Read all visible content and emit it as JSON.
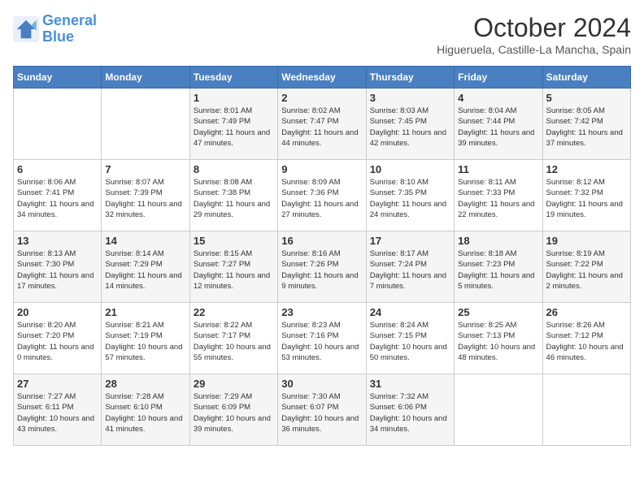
{
  "header": {
    "logo_line1": "General",
    "logo_line2": "Blue",
    "month": "October 2024",
    "location": "Higueruela, Castille-La Mancha, Spain"
  },
  "days_of_week": [
    "Sunday",
    "Monday",
    "Tuesday",
    "Wednesday",
    "Thursday",
    "Friday",
    "Saturday"
  ],
  "weeks": [
    [
      {
        "day": "",
        "sunrise": "",
        "sunset": "",
        "daylight": ""
      },
      {
        "day": "",
        "sunrise": "",
        "sunset": "",
        "daylight": ""
      },
      {
        "day": "1",
        "sunrise": "Sunrise: 8:01 AM",
        "sunset": "Sunset: 7:49 PM",
        "daylight": "Daylight: 11 hours and 47 minutes."
      },
      {
        "day": "2",
        "sunrise": "Sunrise: 8:02 AM",
        "sunset": "Sunset: 7:47 PM",
        "daylight": "Daylight: 11 hours and 44 minutes."
      },
      {
        "day": "3",
        "sunrise": "Sunrise: 8:03 AM",
        "sunset": "Sunset: 7:45 PM",
        "daylight": "Daylight: 11 hours and 42 minutes."
      },
      {
        "day": "4",
        "sunrise": "Sunrise: 8:04 AM",
        "sunset": "Sunset: 7:44 PM",
        "daylight": "Daylight: 11 hours and 39 minutes."
      },
      {
        "day": "5",
        "sunrise": "Sunrise: 8:05 AM",
        "sunset": "Sunset: 7:42 PM",
        "daylight": "Daylight: 11 hours and 37 minutes."
      }
    ],
    [
      {
        "day": "6",
        "sunrise": "Sunrise: 8:06 AM",
        "sunset": "Sunset: 7:41 PM",
        "daylight": "Daylight: 11 hours and 34 minutes."
      },
      {
        "day": "7",
        "sunrise": "Sunrise: 8:07 AM",
        "sunset": "Sunset: 7:39 PM",
        "daylight": "Daylight: 11 hours and 32 minutes."
      },
      {
        "day": "8",
        "sunrise": "Sunrise: 8:08 AM",
        "sunset": "Sunset: 7:38 PM",
        "daylight": "Daylight: 11 hours and 29 minutes."
      },
      {
        "day": "9",
        "sunrise": "Sunrise: 8:09 AM",
        "sunset": "Sunset: 7:36 PM",
        "daylight": "Daylight: 11 hours and 27 minutes."
      },
      {
        "day": "10",
        "sunrise": "Sunrise: 8:10 AM",
        "sunset": "Sunset: 7:35 PM",
        "daylight": "Daylight: 11 hours and 24 minutes."
      },
      {
        "day": "11",
        "sunrise": "Sunrise: 8:11 AM",
        "sunset": "Sunset: 7:33 PM",
        "daylight": "Daylight: 11 hours and 22 minutes."
      },
      {
        "day": "12",
        "sunrise": "Sunrise: 8:12 AM",
        "sunset": "Sunset: 7:32 PM",
        "daylight": "Daylight: 11 hours and 19 minutes."
      }
    ],
    [
      {
        "day": "13",
        "sunrise": "Sunrise: 8:13 AM",
        "sunset": "Sunset: 7:30 PM",
        "daylight": "Daylight: 11 hours and 17 minutes."
      },
      {
        "day": "14",
        "sunrise": "Sunrise: 8:14 AM",
        "sunset": "Sunset: 7:29 PM",
        "daylight": "Daylight: 11 hours and 14 minutes."
      },
      {
        "day": "15",
        "sunrise": "Sunrise: 8:15 AM",
        "sunset": "Sunset: 7:27 PM",
        "daylight": "Daylight: 11 hours and 12 minutes."
      },
      {
        "day": "16",
        "sunrise": "Sunrise: 8:16 AM",
        "sunset": "Sunset: 7:26 PM",
        "daylight": "Daylight: 11 hours and 9 minutes."
      },
      {
        "day": "17",
        "sunrise": "Sunrise: 8:17 AM",
        "sunset": "Sunset: 7:24 PM",
        "daylight": "Daylight: 11 hours and 7 minutes."
      },
      {
        "day": "18",
        "sunrise": "Sunrise: 8:18 AM",
        "sunset": "Sunset: 7:23 PM",
        "daylight": "Daylight: 11 hours and 5 minutes."
      },
      {
        "day": "19",
        "sunrise": "Sunrise: 8:19 AM",
        "sunset": "Sunset: 7:22 PM",
        "daylight": "Daylight: 11 hours and 2 minutes."
      }
    ],
    [
      {
        "day": "20",
        "sunrise": "Sunrise: 8:20 AM",
        "sunset": "Sunset: 7:20 PM",
        "daylight": "Daylight: 11 hours and 0 minutes."
      },
      {
        "day": "21",
        "sunrise": "Sunrise: 8:21 AM",
        "sunset": "Sunset: 7:19 PM",
        "daylight": "Daylight: 10 hours and 57 minutes."
      },
      {
        "day": "22",
        "sunrise": "Sunrise: 8:22 AM",
        "sunset": "Sunset: 7:17 PM",
        "daylight": "Daylight: 10 hours and 55 minutes."
      },
      {
        "day": "23",
        "sunrise": "Sunrise: 8:23 AM",
        "sunset": "Sunset: 7:16 PM",
        "daylight": "Daylight: 10 hours and 53 minutes."
      },
      {
        "day": "24",
        "sunrise": "Sunrise: 8:24 AM",
        "sunset": "Sunset: 7:15 PM",
        "daylight": "Daylight: 10 hours and 50 minutes."
      },
      {
        "day": "25",
        "sunrise": "Sunrise: 8:25 AM",
        "sunset": "Sunset: 7:13 PM",
        "daylight": "Daylight: 10 hours and 48 minutes."
      },
      {
        "day": "26",
        "sunrise": "Sunrise: 8:26 AM",
        "sunset": "Sunset: 7:12 PM",
        "daylight": "Daylight: 10 hours and 46 minutes."
      }
    ],
    [
      {
        "day": "27",
        "sunrise": "Sunrise: 7:27 AM",
        "sunset": "Sunset: 6:11 PM",
        "daylight": "Daylight: 10 hours and 43 minutes."
      },
      {
        "day": "28",
        "sunrise": "Sunrise: 7:28 AM",
        "sunset": "Sunset: 6:10 PM",
        "daylight": "Daylight: 10 hours and 41 minutes."
      },
      {
        "day": "29",
        "sunrise": "Sunrise: 7:29 AM",
        "sunset": "Sunset: 6:09 PM",
        "daylight": "Daylight: 10 hours and 39 minutes."
      },
      {
        "day": "30",
        "sunrise": "Sunrise: 7:30 AM",
        "sunset": "Sunset: 6:07 PM",
        "daylight": "Daylight: 10 hours and 36 minutes."
      },
      {
        "day": "31",
        "sunrise": "Sunrise: 7:32 AM",
        "sunset": "Sunset: 6:06 PM",
        "daylight": "Daylight: 10 hours and 34 minutes."
      },
      {
        "day": "",
        "sunrise": "",
        "sunset": "",
        "daylight": ""
      },
      {
        "day": "",
        "sunrise": "",
        "sunset": "",
        "daylight": ""
      }
    ]
  ]
}
